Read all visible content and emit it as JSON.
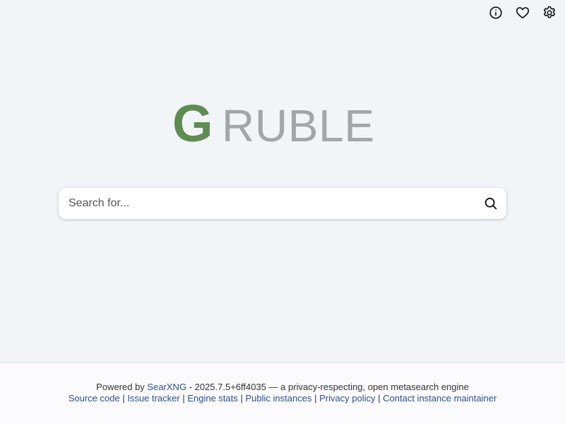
{
  "nav": {
    "info_label": "About",
    "donate_label": "Donate",
    "preferences_label": "Preferences"
  },
  "logo": {
    "first_letter": "G",
    "rest": "RUBLE",
    "color_first": "#5e8c51",
    "color_rest": "#a3a6a8"
  },
  "search": {
    "placeholder": "Search for...",
    "value": ""
  },
  "footer": {
    "powered_prefix": "Powered by ",
    "searxng_link": "SearXNG",
    "version_text": " - 2025.7.5+6ff4035 — a privacy-respecting, open metasearch engine",
    "links": {
      "source_code": "Source code",
      "issue_tracker": "Issue tracker",
      "engine_stats": "Engine stats",
      "public_instances": "Public instances",
      "privacy_policy": "Privacy policy",
      "contact": "Contact instance maintainer"
    },
    "separator": " | "
  }
}
